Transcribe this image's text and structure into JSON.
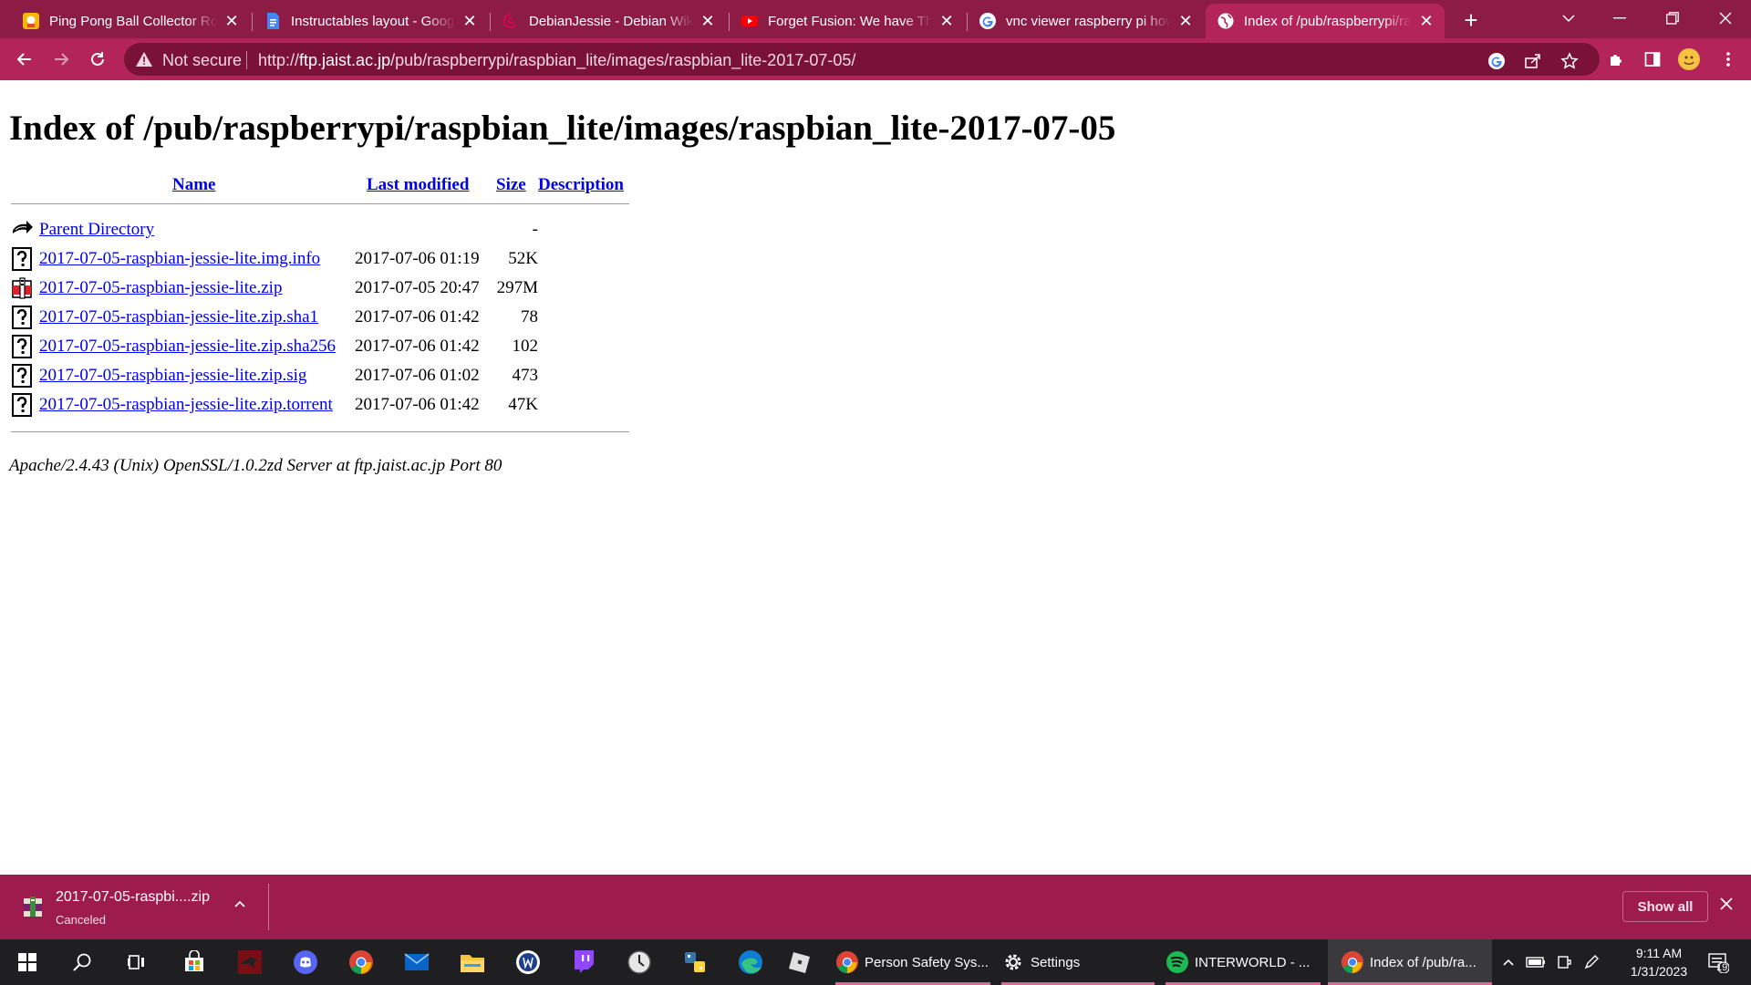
{
  "browser": {
    "tabs": [
      {
        "title": "Ping Pong Ball Collector Robot",
        "favicon": "instructables-icon",
        "active": false
      },
      {
        "title": "Instructables layout - Google Docs",
        "favicon": "google-docs-icon",
        "active": false
      },
      {
        "title": "DebianJessie - Debian Wiki",
        "favicon": "debian-icon",
        "active": false
      },
      {
        "title": "Forget Fusion: We have The",
        "favicon": "youtube-icon",
        "active": false
      },
      {
        "title": "vnc viewer raspberry pi how",
        "favicon": "google-icon",
        "active": false
      },
      {
        "title": "Index of /pub/raspberrypi/ra",
        "favicon": "globe-icon",
        "active": true
      }
    ],
    "security_label": "Not secure",
    "url_prefix": "http://",
    "url_host": "ftp.jaist.ac.jp",
    "url_path": "/pub/raspberrypi/raspbian_lite/images/raspbian_lite-2017-07-05/",
    "theme_color": "#b3255a"
  },
  "page": {
    "title": "Index of /pub/raspberrypi/raspbian_lite/images/raspbian_lite-2017-07-05",
    "columns": {
      "name": "Name",
      "modified": "Last modified",
      "size": "Size",
      "description": "Description"
    },
    "rows": [
      {
        "icon": "back-arrow-icon",
        "name": "Parent Directory",
        "modified": "",
        "size": "-"
      },
      {
        "icon": "unknown-file-icon",
        "name": "2017-07-05-raspbian-jessie-lite.img.info",
        "modified": "2017-07-06 01:19",
        "size": "52K"
      },
      {
        "icon": "compressed-file-icon",
        "name": "2017-07-05-raspbian-jessie-lite.zip",
        "modified": "2017-07-05 20:47",
        "size": "297M"
      },
      {
        "icon": "unknown-file-icon",
        "name": "2017-07-05-raspbian-jessie-lite.zip.sha1",
        "modified": "2017-07-06 01:42",
        "size": "78"
      },
      {
        "icon": "unknown-file-icon",
        "name": "2017-07-05-raspbian-jessie-lite.zip.sha256",
        "modified": "2017-07-06 01:42",
        "size": "102"
      },
      {
        "icon": "unknown-file-icon",
        "name": "2017-07-05-raspbian-jessie-lite.zip.sig",
        "modified": "2017-07-06 01:02",
        "size": "473"
      },
      {
        "icon": "unknown-file-icon",
        "name": "2017-07-05-raspbian-jessie-lite.zip.torrent",
        "modified": "2017-07-06 01:42",
        "size": "47K"
      }
    ],
    "server_signature": "Apache/2.4.43 (Unix) OpenSSL/1.0.2zd Server at ftp.jaist.ac.jp Port 80"
  },
  "downloads": {
    "file_name": "2017-07-05-raspbi....zip",
    "status": "Canceled",
    "show_all_label": "Show all"
  },
  "taskbar": {
    "apps": [
      {
        "label": "Person Safety Sys...",
        "icon": "chrome-icon"
      },
      {
        "label": "Settings",
        "icon": "settings-gear-icon"
      },
      {
        "label": "INTERWORLD - ...",
        "icon": "spotify-icon"
      },
      {
        "label": "Index of /pub/ra...",
        "icon": "chrome-icon"
      }
    ],
    "time": "9:11 AM",
    "date": "1/31/2023",
    "notification_count": "19"
  }
}
